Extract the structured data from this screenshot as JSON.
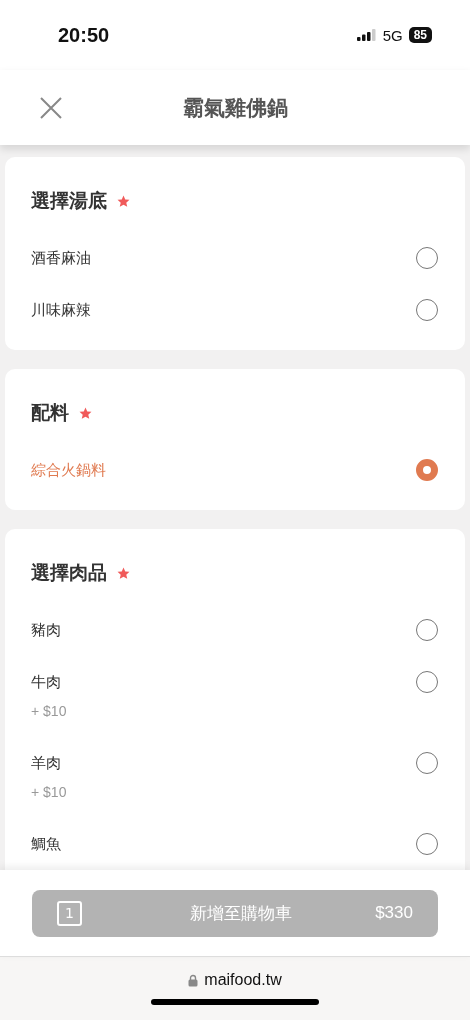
{
  "status_bar": {
    "time": "20:50",
    "network": "5G",
    "battery": "85"
  },
  "header": {
    "title": "霸氣雞佛鍋"
  },
  "sections": [
    {
      "title": "選擇湯底",
      "required": true,
      "options": [
        {
          "name": "酒香麻油",
          "selected": false
        },
        {
          "name": "川味麻辣",
          "selected": false
        }
      ]
    },
    {
      "title": "配料",
      "required": true,
      "options": [
        {
          "name": "綜合火鍋料",
          "selected": true
        }
      ]
    },
    {
      "title": "選擇肉品",
      "required": true,
      "options": [
        {
          "name": "豬肉",
          "selected": false
        },
        {
          "name": "牛肉",
          "price": "+ $10",
          "selected": false
        },
        {
          "name": "羊肉",
          "price": "+ $10",
          "selected": false
        },
        {
          "name": "鯛魚",
          "selected": false
        }
      ]
    }
  ],
  "cart_button": {
    "quantity": "1",
    "label": "新增至購物車",
    "total": "$330"
  },
  "browser": {
    "url": "maifood.tw"
  }
}
